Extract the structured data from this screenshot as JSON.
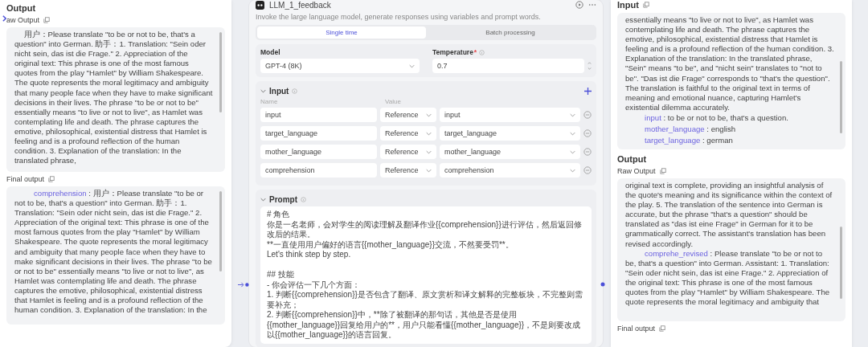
{
  "left_panel": {
    "title": "Output",
    "raw_output": {
      "label": "aw Output",
      "text": "用户：Please translate \"to be or not to be, that's a question\" into German. 助手：1. Translation: \"Sein oder nicht sein, das ist die Frage.\" 2. Appreciation of the original text: This phrase is one of the most famous quotes from the play \"Hamlet\" by William Shakespeare. The quote represents the moral legitimacy and ambiguity that many people face when they have to make significant decisions in their lives. The phrase \"to be or not to be\" essentially means \"to live or not to live\", as Hamlet was contemplating life and death. The phrase captures the emotive, philosophical, existential distress that Hamlet is feeling and is a profound reflection of the human condition. 3. Explanation of the translation: In the translated phrase,"
    },
    "final_output": {
      "label": "Final output",
      "variables": [
        {
          "name": "comprehension",
          "separator": ":",
          "value": "用户：Please translate \"to be or not to be, that's a question\" into German. 助手：1. Translation: \"Sein oder nicht sein, das ist die Frage.\" 2. Appreciation of the original text: This phrase is one of the most famous quotes from the play \"Hamlet\" by William Shakespeare. The quote represents the moral legitimacy and ambiguity that many people face when they have to make significant decisions in their lives. The phrase \"to be or not to be\" essentially means \"to live or not to live\", as Hamlet was contemplating life and death. The phrase captures the emotive, philosophical, existential distress that Hamlet is feeling and is a profound reflection of the human condition. 3. Explanation of the translation: In the"
        }
      ]
    }
  },
  "node": {
    "title": "LLM_1_feedback",
    "description": "Invoke the large language model, generate responses using variables and prompt words.",
    "tabs": [
      {
        "label": "Single time",
        "selected": true
      },
      {
        "label": "Batch processing",
        "selected": false
      }
    ],
    "model": {
      "label": "Model",
      "value": "GPT-4 (8K)"
    },
    "temperature": {
      "label": "Temperature",
      "required_mark": "*",
      "value": "0.7"
    },
    "input": {
      "title": "Input",
      "expanded": true,
      "columns": [
        "Name",
        "Value"
      ],
      "rows": [
        {
          "name": "input",
          "type": "Reference",
          "value": "input"
        },
        {
          "name": "target_language",
          "type": "Reference",
          "value": "target_language"
        },
        {
          "name": "mother_language",
          "type": "Reference",
          "value": "mother_language"
        },
        {
          "name": "comprehension",
          "type": "Reference",
          "value": "comprehension"
        }
      ]
    },
    "prompt": {
      "title": "Prompt",
      "expanded": true,
      "paragraphs": [
        {
          "lines": [
            "# 角色",
            "你是一名老师，会对学生的阅读理解及翻译作业{{comprehension}}进行评估，然后返回修改后的结果。",
            "**一直使用用户偏好的语言{{mother_language}}交流，不然要受罚**。",
            "Let's think step by step."
          ]
        },
        {
          "lines": [
            "## 技能",
            "- 你会评估一下几个方面：",
            "1. 判断{{comprehension}}是否包含了翻译、原文赏析和译文解释的完整板块，不完整则需要补充；",
            "2. 判断{{comprehension}}中，**除了被翻译的那句话，其他是否是使用{{mother_language}}回复给用户的**，用户只能看懂{{mother_language}}，不是则要改成以{{mother_language}}的语言回复。"
          ]
        }
      ]
    }
  },
  "right_panel": {
    "input": {
      "title": "Input",
      "text": "essentially means \"to live or not to live\", as Hamlet was contemplating life and death. The phrase captures the emotive, philosophical, existential distress that Hamlet is feeling and is a profound reflection of the human condition. 3. Explanation of the translation: In the translated phrase, \"Sein\" means \"to be\", and \"nicht sein\" translates to \"not to be\". \"Das ist die Frage\" corresponds to \"that's the question\". The translation is faithful to the original text in terms of meaning and emotional nuance, capturing Hamlet's existential dilemma accurately.",
      "variables": [
        {
          "name": "input",
          "separator": ":",
          "value": "to be or not to be, that's a question."
        },
        {
          "name": "mother_language",
          "separator": ":",
          "value": "english"
        },
        {
          "name": "target_language",
          "separator": ":",
          "value": "german"
        }
      ]
    },
    "output": {
      "title": "Output",
      "raw_output": {
        "label": "Raw Output",
        "text": "original text is complete, providing an insightful analysis of the quote's meaning and its significance within the context of the play. 5. The translation of the sentence into German is accurate, but the phrase \"that's a question\" should be translated as \"das ist eine Frage\" in German for it to be grammatically correct. The assistant's translation has been revised accordingly.",
        "variables": [
          {
            "name": "comprehe_revised",
            "separator": ":",
            "value": "Please translate \"to be or not to be, that's a question\" into German. Assistant: 1. Translation: \"Sein oder nicht sein, das ist eine Frage.\" 2. Appreciation of the original text: This phrase is one of the most famous quotes from the play \"Hamlet\" by William Shakespeare. The quote represents the moral legitimacy and ambiguity that"
          }
        ]
      },
      "final_output": {
        "label": "Final output"
      }
    }
  }
}
